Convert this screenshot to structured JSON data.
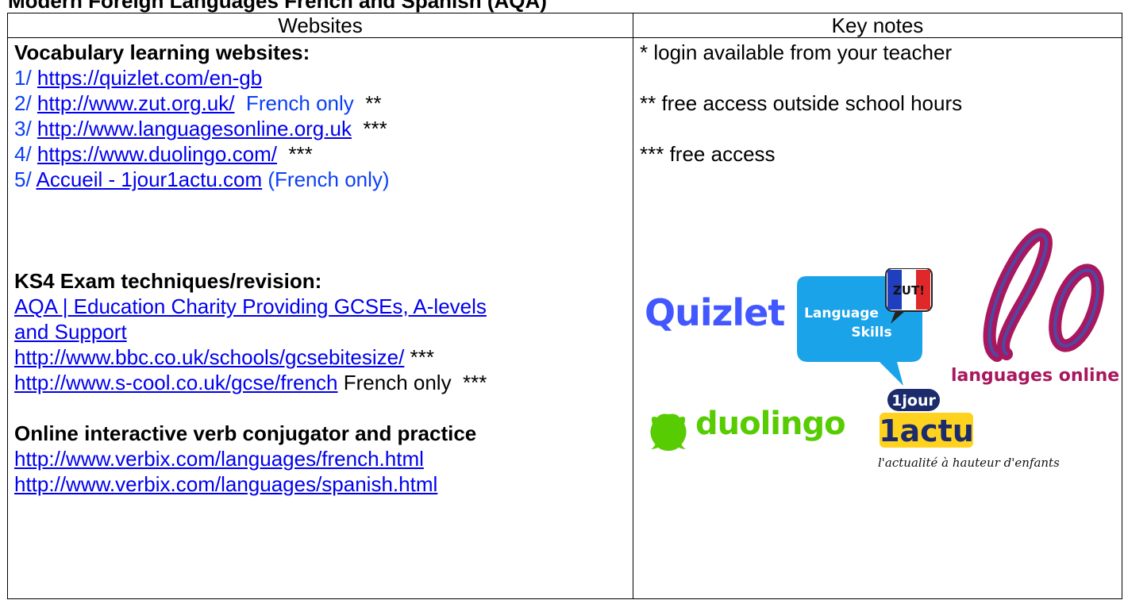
{
  "page": {
    "title": "Modern Foreign Languages French and Spanish (AQA)"
  },
  "table": {
    "headers": [
      "Websites",
      "Key notes"
    ]
  },
  "vocab": {
    "heading": "Vocabulary learning websites:",
    "items": [
      {
        "num": "1/ ",
        "link": "https://quizlet.com/en-gb",
        "suffix": ""
      },
      {
        "num": "2/ ",
        "link": "http://www.zut.org.uk/",
        "suffix_blue": "  French only",
        "suffix": "  **"
      },
      {
        "num": "3/ ",
        "link": "http://www.languagesonline.org.uk",
        "suffix": "  ***"
      },
      {
        "num": "4/ ",
        "link": "https://www.duolingo.com/",
        "suffix": "  ***"
      },
      {
        "num": "5/ ",
        "link": "Accueil - 1jour1actu.com",
        "suffix_blue": " (French only)"
      }
    ]
  },
  "ks4": {
    "heading": "KS4 Exam techniques/revision:",
    "aqa_link_line1": "AQA | Education Charity Providing GCSEs, A-levels",
    "aqa_link_line2": "and Support",
    "bbc_link": "http://www.bbc.co.uk/schools/gcsebitesize/",
    "bbc_suffix": " ***",
    "scool_link": "http://www.s-cool.co.uk/gcse/french",
    "scool_suffix": " French only  ***"
  },
  "verb": {
    "heading": "Online interactive verb conjugator and practice",
    "french_link": "http://www.verbix.com/languages/french.html",
    "spanish_link": "http://www.verbix.com/languages/spanish.html"
  },
  "notes": [
    "* login available from your teacher",
    "** free access outside school hours",
    "*** free access"
  ],
  "logos": {
    "quizlet": "Quizlet",
    "zut_badge": "ZUT!",
    "zut_line1": "Language",
    "zut_line2": "Skills",
    "languages_online": "languages online",
    "duolingo": "duolingo",
    "oneactu_top": "1jour",
    "oneactu_main": "1actu",
    "oneactu_tagline": "l'actualité à hauteur d'enfants"
  },
  "colors": {
    "link": "#0000ee",
    "blue_text": "#0b3ff5",
    "quizlet": "#4257ff",
    "zut_blue": "#1aa3e8",
    "lo_red": "#a8185e",
    "duolingo": "#58cc02",
    "oneactu_yellow": "#ffd21f",
    "oneactu_navy": "#1b2b6b"
  }
}
